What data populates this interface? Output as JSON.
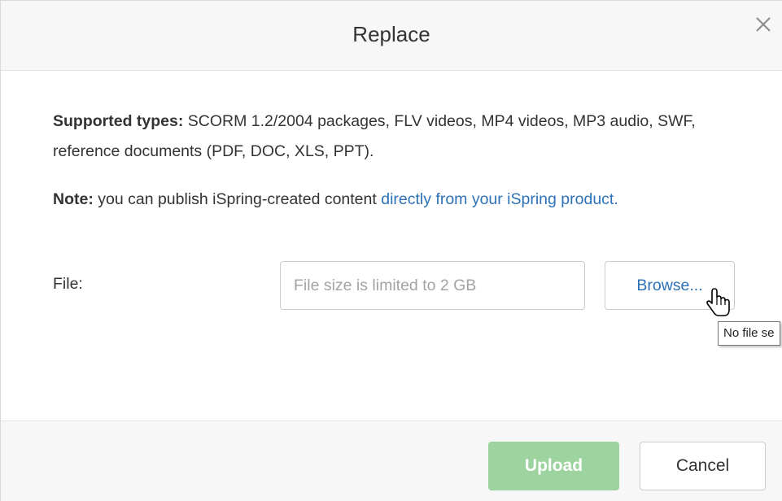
{
  "dialog": {
    "title": "Replace",
    "close_icon": "close-icon"
  },
  "info": {
    "supported_label": "Supported types:",
    "supported_text": " SCORM 1.2/2004 packages, FLV videos, MP4 videos, MP3 audio, SWF, reference documents (PDF, DOC, XLS, PPT).",
    "note_label": "Note:",
    "note_text": " you can publish iSpring-created content ",
    "note_link": "directly from your iSpring product."
  },
  "file": {
    "label": "File:",
    "value": "",
    "placeholder": "File size is limited to 2 GB",
    "browse_label": "Browse...",
    "cursor_icon": "hand-pointer-icon",
    "tooltip": "No file se"
  },
  "footer": {
    "upload_label": "Upload",
    "cancel_label": "Cancel"
  },
  "colors": {
    "link": "#2d72b8",
    "upload_disabled": "#9dd39f",
    "header_bg": "#f7f7f7"
  }
}
